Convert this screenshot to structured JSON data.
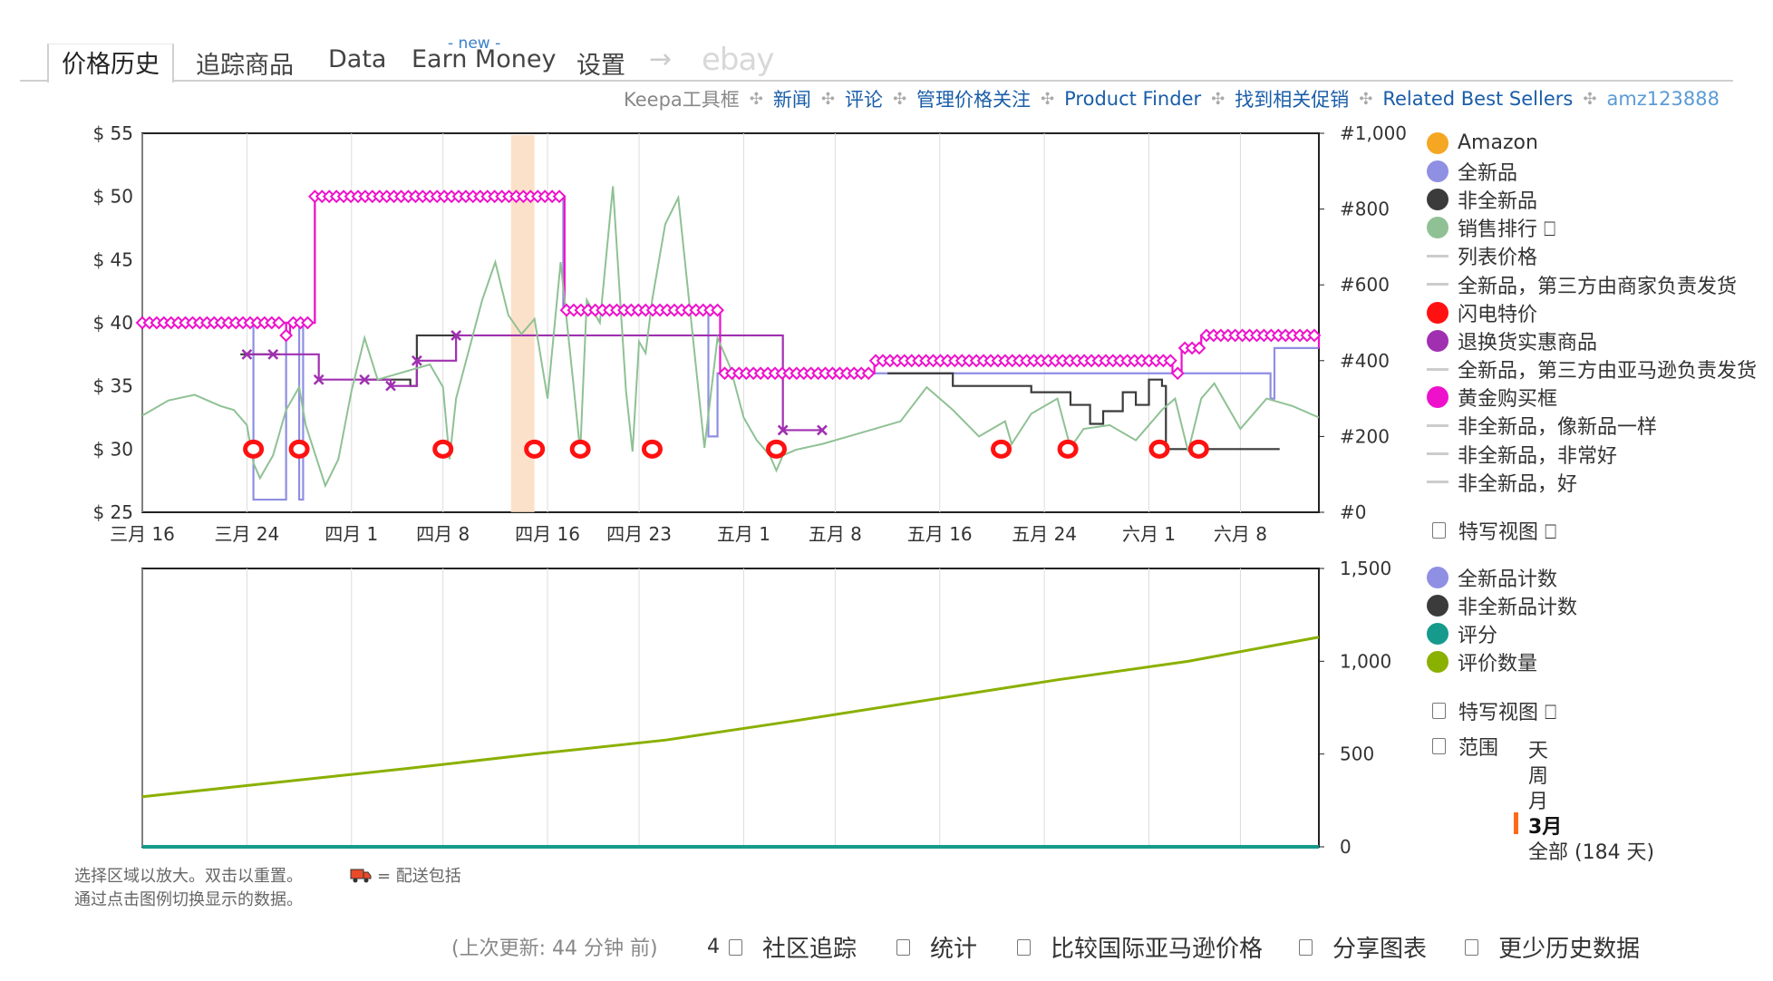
{
  "tabs": {
    "price_history": "价格历史",
    "tracking": "追踪商品",
    "data": "Data",
    "earn_money_badge": "- new -",
    "earn_money": "Earn Money",
    "settings": "设置",
    "arrow": "→",
    "ebay": "ebay"
  },
  "toolbar": {
    "brand": "Keepa工具框",
    "links": [
      "新闻",
      "评论",
      "管理价格关注",
      "Product Finder",
      "找到相关促销",
      "Related Best Sellers"
    ],
    "account": "amz123888",
    "separator": "✣"
  },
  "price_legend": [
    {
      "label": "Amazon",
      "kind": "dot",
      "color": "#f5a623"
    },
    {
      "label": "全新品",
      "kind": "dot",
      "color": "#8f8fe3"
    },
    {
      "label": "非全新品",
      "kind": "dot",
      "color": "#3b3b3b"
    },
    {
      "label": "销售排行 ⎕",
      "kind": "dot",
      "color": "#8fc194"
    },
    {
      "label": "列表价格",
      "kind": "dash",
      "color": "#cccccc"
    },
    {
      "label": "全新品，第三方由商家负责发货",
      "kind": "dash",
      "color": "#cccccc"
    },
    {
      "label": "闪电特价",
      "kind": "dot",
      "color": "#ff1111"
    },
    {
      "label": "退换货实惠商品",
      "kind": "dot",
      "color": "#a030b0"
    },
    {
      "label": "全新品，第三方由亚马逊负责发货",
      "kind": "dash",
      "color": "#cccccc"
    },
    {
      "label": "黄金购买框",
      "kind": "dot",
      "color": "#ee11cc"
    },
    {
      "label": "非全新品，像新品一样",
      "kind": "dash",
      "color": "#cccccc"
    },
    {
      "label": "非全新品，非常好",
      "kind": "dash",
      "color": "#cccccc"
    },
    {
      "label": "非全新品，好",
      "kind": "dash",
      "color": "#cccccc"
    }
  ],
  "closeup_label": "特写视图 ⎕",
  "count_legend": [
    {
      "label": "全新品计数",
      "color": "#8f8fe3"
    },
    {
      "label": "非全新品计数",
      "color": "#3b3b3b"
    },
    {
      "label": "评分",
      "color": "#159a8c"
    },
    {
      "label": "评价数量",
      "color": "#8ab000"
    }
  ],
  "range": {
    "label": "范围",
    "options": [
      "天",
      "周",
      "月",
      "3月",
      "全部 (184 天)"
    ],
    "selected": "3月"
  },
  "notes": {
    "line1": "选择区域以放大。双击以重置。",
    "shipping": "= 配送包括",
    "line2": "通过点击图例切换显示的数据。"
  },
  "bottom_bar": {
    "last_update": "(上次更新:  44 分钟 前)",
    "count": "4",
    "items": [
      "社区追踪",
      "统计",
      "比较国际亚马逊价格",
      "分享图表",
      "更少历史数据"
    ]
  },
  "chart_data": [
    {
      "type": "line",
      "title": "",
      "x_tick_labels": [
        "三月 16",
        "三月 24",
        "四月 1",
        "四月 8",
        "四月 16",
        "四月 23",
        "五月 1",
        "五月 8",
        "五月 16",
        "五月 24",
        "六月 1",
        "六月 8"
      ],
      "y_tick_labels": [
        "$ 55",
        "$ 50",
        "$ 45",
        "$ 40",
        "$ 35",
        "$ 30",
        "$ 25"
      ],
      "y2_tick_labels": [
        "#1,000",
        "#800",
        "#600",
        "#400",
        "#200",
        "#0"
      ],
      "xlim_days": [
        0,
        90
      ],
      "ylim": [
        25,
        55
      ],
      "y2lim": [
        0,
        1000
      ],
      "x_unit": "days since 三月 16",
      "highlight_band_days": [
        28.2,
        30
      ],
      "series": [
        {
          "name": "全新品",
          "color": "#8f8fe3",
          "step": true,
          "x": [
            0,
            8,
            8.5,
            10.5,
            11,
            11.8,
            12,
            12.3,
            13,
            13.2,
            32,
            32.2,
            32.5,
            43,
            43.3,
            44,
            44.2,
            86,
            86.3,
            86.6,
            88,
            90
          ],
          "y": [
            40,
            40,
            26,
            26,
            40,
            40,
            26,
            40,
            40,
            50,
            50,
            41,
            41,
            41,
            31,
            36,
            36,
            36,
            34,
            38,
            38,
            38
          ]
        },
        {
          "name": "黄金购买框",
          "color": "#ee11cc",
          "step": true,
          "x": [
            0,
            10.5,
            11,
            11.3,
            12,
            13.2,
            31.8,
            32.3,
            43.5,
            44.2,
            55,
            56,
            78.8,
            79.5,
            81,
            90
          ],
          "y": [
            40,
            40,
            39,
            40,
            40,
            50,
            50,
            41,
            41,
            36,
            36,
            37,
            36,
            38,
            39,
            38
          ]
        },
        {
          "name": "非全新品",
          "color": "#3b3b3b",
          "step": true,
          "x": [
            7.5,
            10.5,
            13.5,
            17,
            20.5,
            21,
            24.5,
            56,
            57,
            62,
            68,
            71,
            72.5,
            73.5,
            74,
            75,
            76,
            77,
            78,
            78.3,
            80,
            87
          ],
          "y": [
            37.5,
            37.5,
            null,
            35.5,
            35,
            39,
            39,
            null,
            36,
            35,
            34.5,
            33.5,
            32,
            33,
            33,
            34.5,
            33.5,
            35.5,
            35,
            30,
            30,
            30
          ]
        },
        {
          "name": "退换货实惠商品",
          "color": "#a030b0",
          "step": true,
          "x": [
            8,
            10,
            13.5,
            17,
            19,
            21,
            24,
            49,
            52
          ],
          "y": [
            37.5,
            37.5,
            35.5,
            35.5,
            35,
            37,
            39,
            31.5,
            31.5
          ]
        },
        {
          "name": "闪电特价",
          "color": "#ff1111",
          "type": "scatter",
          "x": [
            8.5,
            12,
            23,
            30,
            33.5,
            39,
            48.5,
            65.7,
            70.8,
            77.8,
            80.8
          ],
          "y": [
            30,
            30,
            30,
            30,
            30,
            30,
            30,
            30,
            30,
            30,
            30
          ]
        },
        {
          "name": "销售排行",
          "color": "#8fc194",
          "axis": "y2",
          "x": [
            0,
            2,
            4,
            6,
            7,
            8,
            8.5,
            9,
            10,
            11,
            12,
            12.5,
            14,
            15,
            16,
            17,
            18,
            20,
            22,
            23,
            23.5,
            24,
            26,
            27,
            28,
            29,
            30,
            31,
            32,
            33,
            33.5,
            34,
            35,
            36,
            37,
            37.5,
            38,
            38.5,
            39,
            40,
            41,
            42,
            43,
            44,
            45,
            46,
            47,
            48,
            48.5,
            49,
            50,
            52,
            54,
            56,
            58,
            60,
            62,
            64,
            66,
            66.5,
            68,
            70,
            71,
            72,
            74,
            76,
            78,
            79,
            80,
            81,
            82,
            84,
            86,
            88,
            90
          ],
          "y": [
            255,
            295,
            310,
            280,
            270,
            230,
            130,
            90,
            150,
            270,
            330,
            230,
            70,
            140,
            320,
            460,
            350,
            370,
            390,
            330,
            140,
            300,
            560,
            660,
            520,
            470,
            510,
            300,
            660,
            330,
            160,
            560,
            500,
            860,
            320,
            160,
            450,
            420,
            560,
            760,
            830,
            500,
            170,
            460,
            380,
            250,
            190,
            150,
            110,
            150,
            165,
            180,
            200,
            220,
            240,
            330,
            270,
            200,
            240,
            180,
            260,
            300,
            170,
            220,
            230,
            190,
            270,
            300,
            160,
            300,
            340,
            220,
            300,
            280,
            250
          ]
        }
      ],
      "legend_position": "right"
    },
    {
      "type": "line",
      "title": "",
      "x_tick_labels": [],
      "y_tick_labels": [
        "1,500",
        "1,000",
        "500",
        "0"
      ],
      "xlim_days": [
        0,
        90
      ],
      "ylim": [
        0,
        1500
      ],
      "series": [
        {
          "name": "评价数量",
          "color": "#8ab000",
          "x": [
            0,
            10,
            20,
            30,
            40,
            50,
            60,
            70,
            80,
            90
          ],
          "y": [
            270,
            345,
            420,
            500,
            575,
            680,
            790,
            900,
            1000,
            1130
          ]
        },
        {
          "name": "评分",
          "color": "#159a8c",
          "x": [
            0,
            90
          ],
          "y": [
            0,
            0
          ]
        }
      ],
      "legend_position": "right"
    }
  ]
}
